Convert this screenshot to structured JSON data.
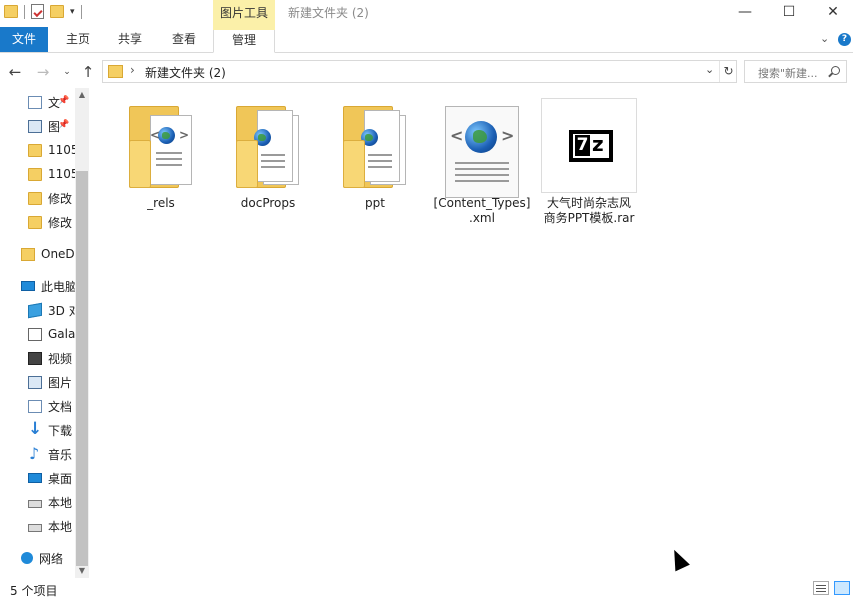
{
  "window": {
    "contextual_tab_group": "图片工具",
    "title": "新建文件夹 (2)",
    "minimize_icon": "minimize-icon",
    "maximize_icon": "maximize-icon",
    "close_icon": "close-icon"
  },
  "ribbon": {
    "tabs": [
      {
        "label": "文件"
      },
      {
        "label": "主页"
      },
      {
        "label": "共享"
      },
      {
        "label": "查看"
      },
      {
        "label": "管理"
      }
    ],
    "active_tab": "管理",
    "file_tab_color": "#1979ca",
    "context_color": "#fbf0a9"
  },
  "address": {
    "path": "新建文件夹 (2)",
    "search_placeholder": "搜索\"新建...",
    "back_icon": "back-arrow-icon",
    "forward_icon": "forward-arrow-icon",
    "up_icon": "up-arrow-icon",
    "refresh_icon": "refresh-icon"
  },
  "nav_pane": {
    "items": [
      {
        "label": "文",
        "icon": "documents-icon",
        "pinned": true
      },
      {
        "label": "图",
        "icon": "pictures-icon",
        "pinned": true
      },
      {
        "label": "1105",
        "icon": "folder-icon"
      },
      {
        "label": "1105",
        "icon": "folder-icon"
      },
      {
        "label": "修改",
        "icon": "folder-icon"
      },
      {
        "label": "修改",
        "icon": "folder-icon"
      },
      {
        "label": "OneD",
        "icon": "onedrive-icon"
      },
      {
        "label": "此电脑",
        "icon": "computer-icon"
      },
      {
        "label": "3D 对",
        "icon": "3d-objects-icon"
      },
      {
        "label": "Gala",
        "icon": "gallery-icon"
      },
      {
        "label": "视频",
        "icon": "videos-icon"
      },
      {
        "label": "图片",
        "icon": "pictures-icon"
      },
      {
        "label": "文档",
        "icon": "documents-icon"
      },
      {
        "label": "下载",
        "icon": "downloads-icon"
      },
      {
        "label": "音乐",
        "icon": "music-icon"
      },
      {
        "label": "桌面",
        "icon": "desktop-icon"
      },
      {
        "label": "本地",
        "icon": "drive-icon"
      },
      {
        "label": "本地",
        "icon": "drive-icon"
      },
      {
        "label": "网络",
        "icon": "network-icon"
      }
    ]
  },
  "files": [
    {
      "name": "_rels",
      "type": "xml-folder"
    },
    {
      "name": "docProps",
      "type": "xml-folder"
    },
    {
      "name": "ppt",
      "type": "xml-folder"
    },
    {
      "name": "[Content_Types].xml",
      "line1": "[Content_Types]",
      "line2": ".xml",
      "type": "xml-file"
    },
    {
      "name": "大气时尚杂志风商务PPT模板.rar",
      "line1": "大气时尚杂志风",
      "line2": "商务PPT模板.rar",
      "type": "7z-archive"
    }
  ],
  "status": {
    "item_count": "5 个项目"
  }
}
